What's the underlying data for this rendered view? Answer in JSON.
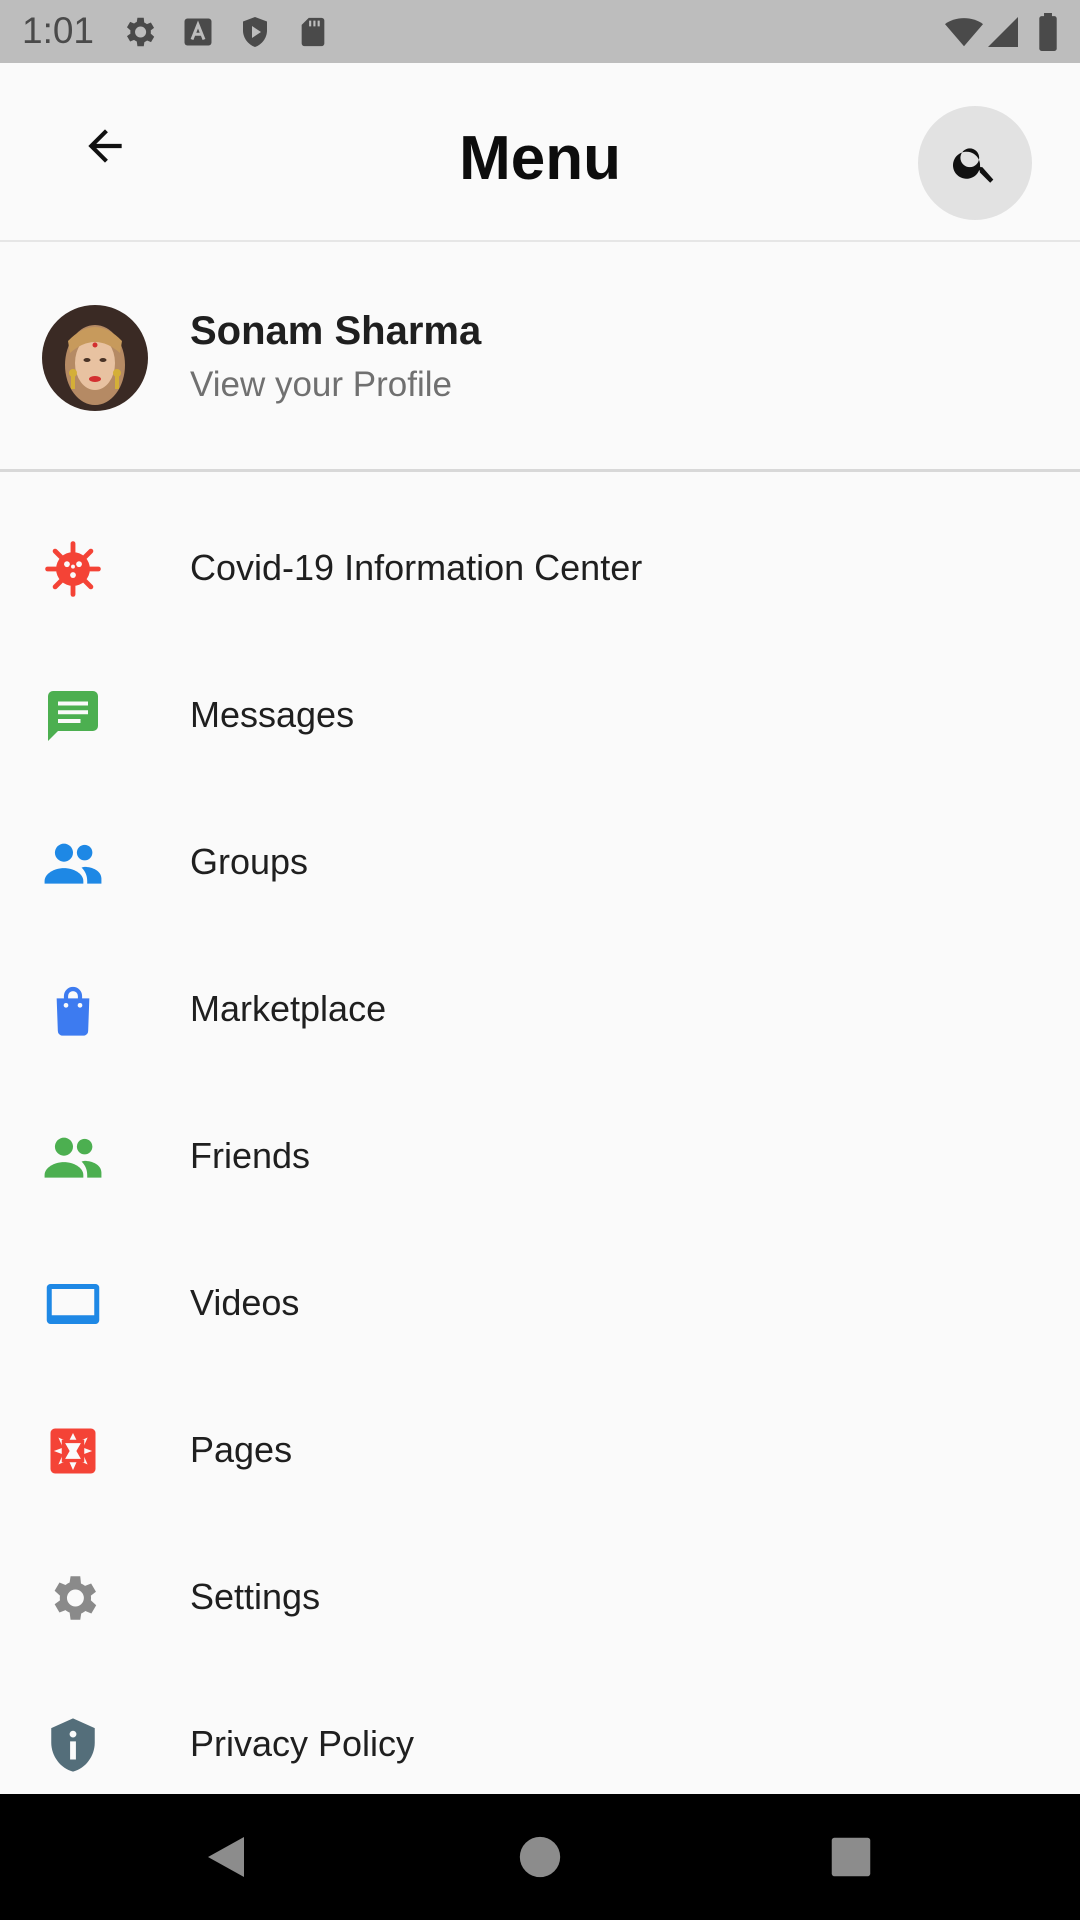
{
  "status_bar": {
    "time": "1:01"
  },
  "app_bar": {
    "title": "Menu"
  },
  "profile": {
    "name": "Sonam Sharma",
    "subtitle": "View your Profile"
  },
  "menu": {
    "items": [
      {
        "label": "Covid-19 Information Center",
        "icon": "virus-icon",
        "color": "#F44336"
      },
      {
        "label": "Messages",
        "icon": "message-icon",
        "color": "#4CAF50"
      },
      {
        "label": "Groups",
        "icon": "groups-icon",
        "color": "#1E88E5"
      },
      {
        "label": "Marketplace",
        "icon": "shopping-bag-icon",
        "color": "#3D7BF0"
      },
      {
        "label": "Friends",
        "icon": "friends-icon",
        "color": "#4CAF50"
      },
      {
        "label": "Videos",
        "icon": "video-screen-icon",
        "color": "#1E88E5"
      },
      {
        "label": "Pages",
        "icon": "pages-flag-icon",
        "color": "#F44336"
      },
      {
        "label": "Settings",
        "icon": "gear-icon",
        "color": "#8A8A8A"
      },
      {
        "label": "Privacy Policy",
        "icon": "privacy-shield-icon",
        "color": "#546E7A"
      }
    ]
  }
}
